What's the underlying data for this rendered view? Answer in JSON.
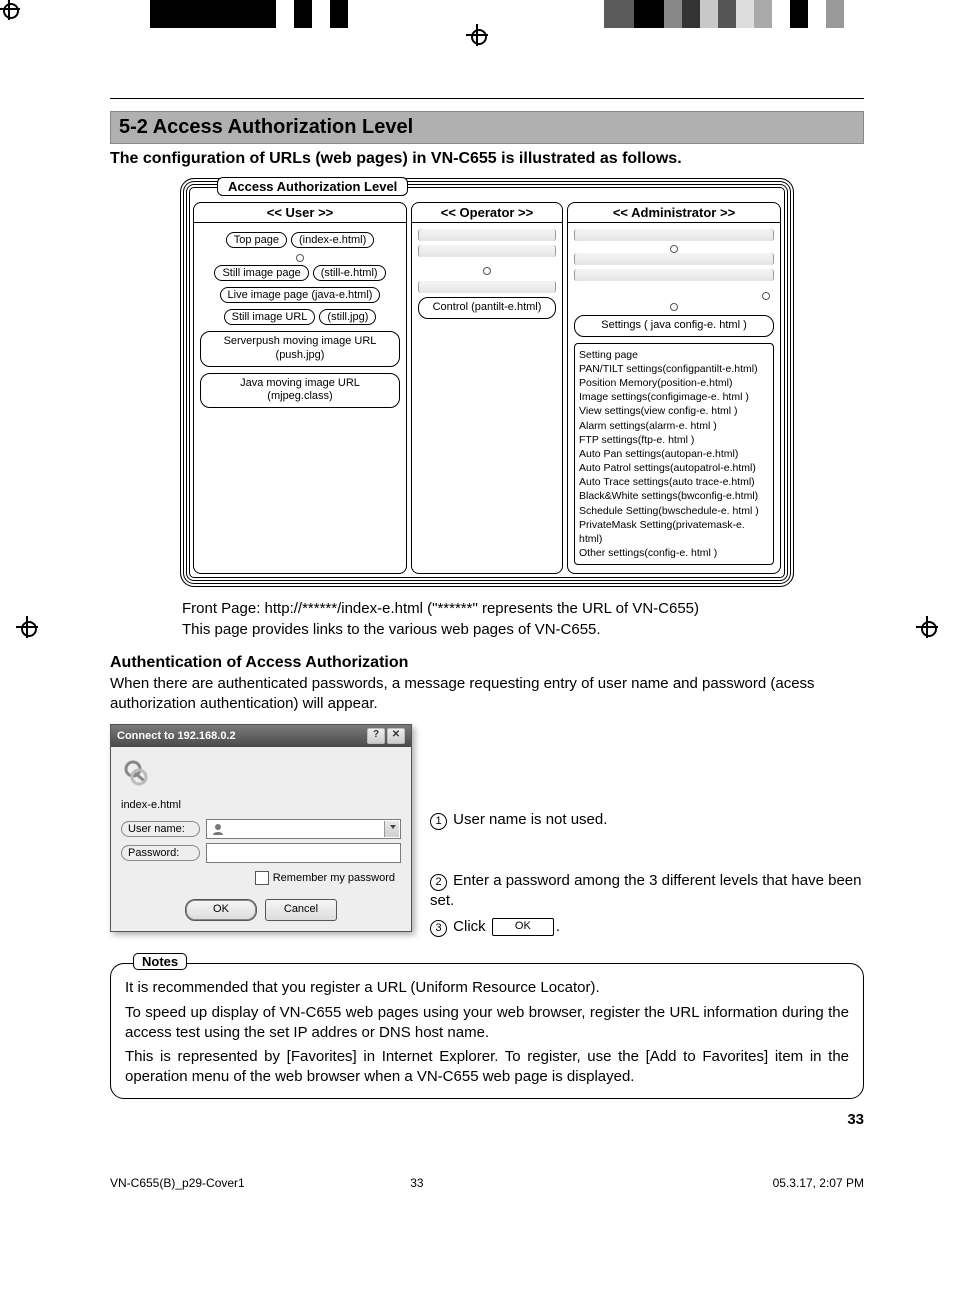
{
  "section_title": "5-2 Access Authorization Level",
  "intro": "The configuration of URLs (web pages) in VN-C655 is illustrated as follows.",
  "diagram": {
    "legend": "Access Authorization Level",
    "columns": {
      "user": {
        "head": "<< User >>",
        "rows": [
          [
            "Top page",
            "(index-e.html)"
          ],
          [
            "Still image page",
            "(still-e.html)"
          ],
          [
            "Live image page (java-e.html)"
          ],
          [
            "Still image URL",
            "(still.jpg)"
          ]
        ],
        "blocks": [
          "Serverpush moving image URL\n(push.jpg)",
          "Java moving image URL\n(mjpeg.class)"
        ]
      },
      "operator": {
        "head": "<< Operator >>",
        "control": "Control (pantilt-e.html)"
      },
      "admin": {
        "head": "<< Administrator >>",
        "settings_pill": "Settings ( java config-e. html )",
        "settings_header": "Setting page",
        "settings": [
          "PAN/TILT settings(configpantilt-e.html)",
          "Position Memory(position-e.html)",
          "Image settings(configimage-e. html )",
          "View settings(view config-e. html )",
          "Alarm settings(alarm-e. html )",
          "FTP settings(ftp-e. html )",
          "Auto Pan settings(autopan-e.html)",
          "Auto Patrol settings(autopatrol-e.html)",
          "Auto Trace settings(auto trace-e.html)",
          "Black&White settings(bwconfig-e.html)",
          "Schedule Setting(bwschedule-e. html )",
          "PrivateMask Setting(privatemask-e. html)",
          "Other settings(config-e. html )"
        ]
      }
    }
  },
  "caption1": "Front Page: http://******/index-e.html (\"******\" represents the URL of VN-C655)",
  "caption2": "This page provides links to the various web pages of VN-C655.",
  "auth_heading": "Authentication of Access Authorization",
  "auth_body": "When there are authenticated passwords, a message requesting entry of user name and password (acess authorization authentication) will appear.",
  "dialog": {
    "title": "Connect to 192.168.0.2",
    "realm": "index-e.html",
    "user_label": "User name:",
    "user_value": "",
    "pass_label": "Password:",
    "remember": "Remember my password",
    "ok": "OK",
    "cancel": "Cancel"
  },
  "steps": {
    "s1": "User name is not used.",
    "s2": "Enter a password among the 3 different levels that have been set.",
    "s3a": "Click",
    "s3b": ".",
    "ok_inline": "OK"
  },
  "notes": {
    "label": "Notes",
    "p1": "It is recommended that you register a URL (Uniform Resource Locator).",
    "p2": "To speed up display of VN-C655 web pages using your web browser, register the URL information during the access test using the set IP addres or DNS host name.",
    "p3": "This is represented by [Favorites] in Internet Explorer. To register, use the [Add to Favorites] item in the operation menu of the web browser when a VN-C655 web page is displayed."
  },
  "page_number": "33",
  "footer": {
    "left": "VN-C655(B)_p29-Cover1",
    "center": "33",
    "right": "05.3.17, 2:07 PM"
  }
}
